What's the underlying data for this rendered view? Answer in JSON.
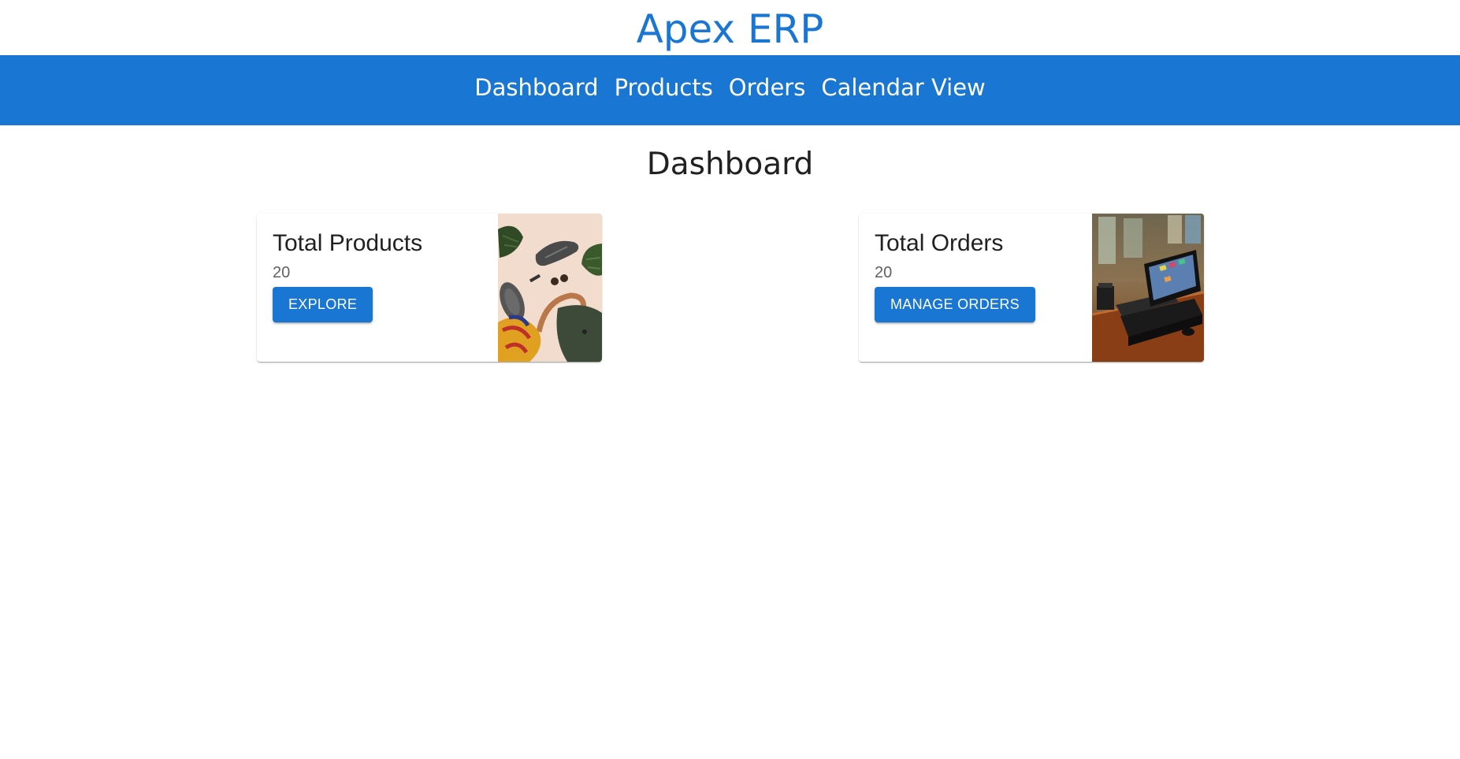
{
  "app": {
    "title": "Apex ERP",
    "brand_color": "#1976d2"
  },
  "nav": {
    "items": [
      {
        "label": "Dashboard"
      },
      {
        "label": "Products"
      },
      {
        "label": "Orders"
      },
      {
        "label": "Calendar View"
      }
    ]
  },
  "page": {
    "heading": "Dashboard"
  },
  "cards": [
    {
      "title": "Total Products",
      "count": "20",
      "button_label": "EXPLORE",
      "image": "flat-lay-fashion-accessories-photo"
    },
    {
      "title": "Total Orders",
      "count": "20",
      "button_label": "MANAGE ORDERS",
      "image": "pos-terminal-photo"
    }
  ]
}
